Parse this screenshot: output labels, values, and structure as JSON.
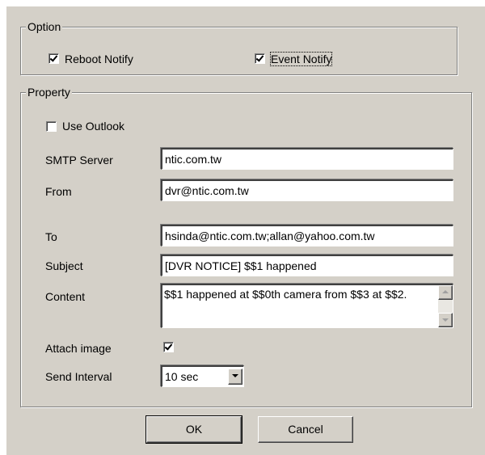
{
  "option": {
    "legend": "Option",
    "reboot_notify": {
      "label": "Reboot Notify",
      "checked": true
    },
    "event_notify": {
      "label": "Event Notify",
      "checked": true
    }
  },
  "property": {
    "legend": "Property",
    "use_outlook": {
      "label": "Use Outlook",
      "checked": false
    },
    "smtp_server": {
      "label": "SMTP Server",
      "value": "ntic.com.tw"
    },
    "from": {
      "label": "From",
      "value": "dvr@ntic.com.tw"
    },
    "to": {
      "label": "To",
      "value": "hsinda@ntic.com.tw;allan@yahoo.com.tw"
    },
    "subject": {
      "label": "Subject",
      "value": "[DVR NOTICE] $$1 happened"
    },
    "content": {
      "label": "Content",
      "value": "$$1 happened at $$0th camera from $$3 at $$2."
    },
    "attach_image": {
      "label": "Attach image",
      "checked": true
    },
    "send_interval": {
      "label": "Send Interval",
      "value": "10 sec"
    }
  },
  "buttons": {
    "ok": "OK",
    "cancel": "Cancel"
  }
}
